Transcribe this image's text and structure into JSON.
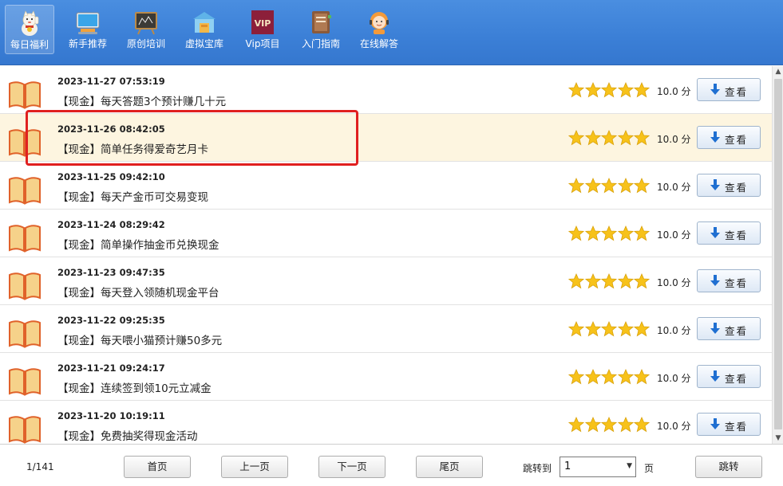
{
  "toolbar": {
    "items": [
      {
        "label": "每日福利",
        "icon": "lucky-cat-icon",
        "active": true
      },
      {
        "label": "新手推荐",
        "icon": "monitor-icon",
        "active": false
      },
      {
        "label": "原创培训",
        "icon": "blackboard-icon",
        "active": false
      },
      {
        "label": "虚拟宝库",
        "icon": "warehouse-icon",
        "active": false
      },
      {
        "label": "Vip项目",
        "icon": "vip-icon",
        "active": false
      },
      {
        "label": "入门指南",
        "icon": "guide-book-icon",
        "active": false
      },
      {
        "label": "在线解答",
        "icon": "support-agent-icon",
        "active": false
      }
    ]
  },
  "list": {
    "rows": [
      {
        "date": "2023-11-27 07:53:19",
        "title": "【现金】每天答题3个预计赚几十元",
        "rating_stars": 5,
        "score": "10.0 分",
        "button": "查看"
      },
      {
        "date": "2023-11-26 08:42:05",
        "title": "【现金】简单任务得爱奇艺月卡",
        "rating_stars": 5,
        "score": "10.0 分",
        "button": "查看"
      },
      {
        "date": "2023-11-25 09:42:10",
        "title": "【现金】每天产金币可交易变现",
        "rating_stars": 5,
        "score": "10.0 分",
        "button": "查看"
      },
      {
        "date": "2023-11-24 08:29:42",
        "title": "【现金】简单操作抽金币兑换现金",
        "rating_stars": 5,
        "score": "10.0 分",
        "button": "查看"
      },
      {
        "date": "2023-11-23 09:47:35",
        "title": "【现金】每天登入领随机现金平台",
        "rating_stars": 5,
        "score": "10.0 分",
        "button": "查看"
      },
      {
        "date": "2023-11-22 09:25:35",
        "title": "【现金】每天喂小猫预计赚50多元",
        "rating_stars": 5,
        "score": "10.0 分",
        "button": "查看"
      },
      {
        "date": "2023-11-21 09:24:17",
        "title": "【现金】连续签到领10元立减金",
        "rating_stars": 5,
        "score": "10.0 分",
        "button": "查看"
      },
      {
        "date": "2023-11-20 10:19:11",
        "title": "【现金】免费抽奖得现金活动",
        "rating_stars": 5,
        "score": "10.0 分",
        "button": "查看"
      }
    ]
  },
  "footer": {
    "page_info": "1/141",
    "first": "首页",
    "prev": "上一页",
    "next": "下一页",
    "last": "尾页",
    "jump_label": "跳转到",
    "page_value": "1",
    "page_unit": "页",
    "jump_button": "跳转"
  },
  "colors": {
    "toolbar": "#3b7fd6",
    "highlight_row": "#fdf5e0",
    "annotation_box": "#e02020",
    "star": "#f7c21a"
  }
}
